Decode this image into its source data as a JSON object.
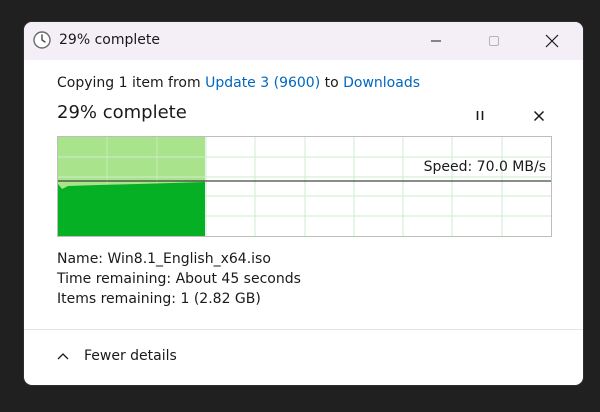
{
  "window": {
    "title": "29% complete"
  },
  "copy": {
    "prefix": "Copying 1 item from",
    "source": "Update 3 (9600)",
    "middle": "to",
    "destination": "Downloads"
  },
  "status": {
    "percent_text": "29% complete",
    "progress": 0.29
  },
  "graph": {
    "speed_label": "Speed: 70.0 MB/s"
  },
  "details": {
    "name_label": "Name:",
    "name_value": "Win8.1_English_x64.iso",
    "time_label": "Time remaining:",
    "time_value": "About 45 seconds",
    "items_label": "Items remaining:",
    "items_value": "1 (2.82 GB)"
  },
  "footer": {
    "toggle_label": "Fewer details"
  },
  "colors": {
    "progress_fill": "#a9e38c",
    "speed_fill": "#06b025",
    "grid_line": "#cdeccd",
    "link": "#0067c0"
  }
}
